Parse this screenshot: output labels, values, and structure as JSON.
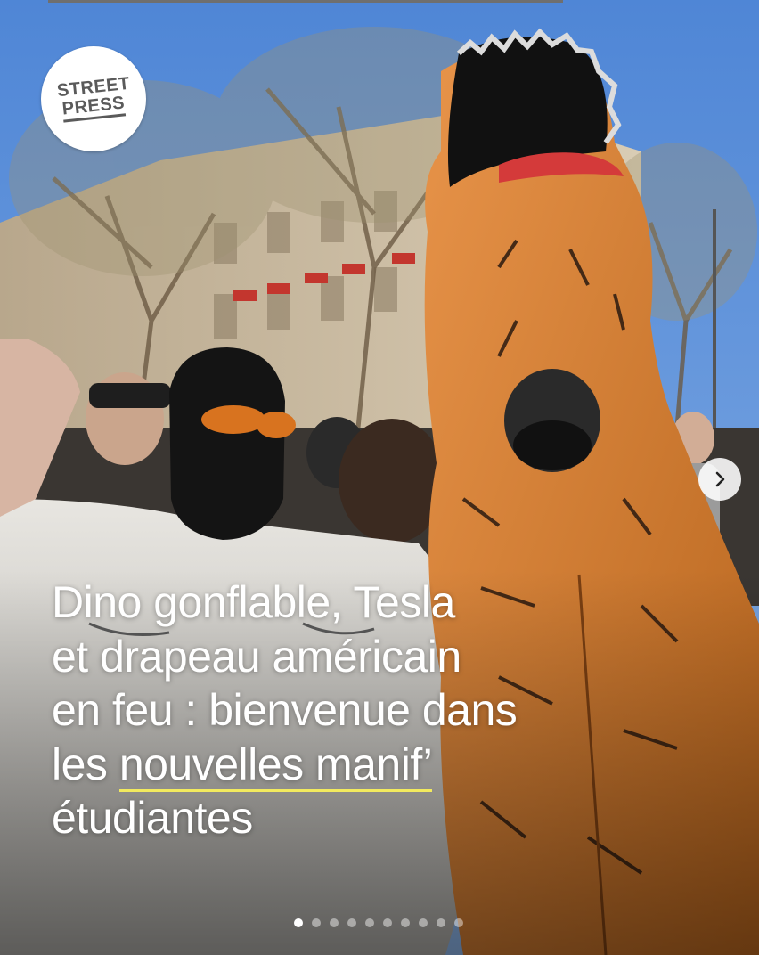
{
  "logo": {
    "line1": "STREET",
    "line2": "PRESS"
  },
  "headline": {
    "line1": "Dino gonflable, Tesla",
    "line2": "et drapeau américain",
    "line3": "en feu : bienvenue dans",
    "line4_prefix": "les ",
    "line4_highlight": "nouvelles manif’",
    "line5": "étudiantes"
  },
  "carousel": {
    "total_slides": 10,
    "current_slide": 1
  },
  "colors": {
    "highlight_underline": "#f2ea5e",
    "dino_orange": "#d9822b",
    "sky": "#5d8fd6"
  },
  "icons": {
    "next": "chevron-right-icon"
  }
}
